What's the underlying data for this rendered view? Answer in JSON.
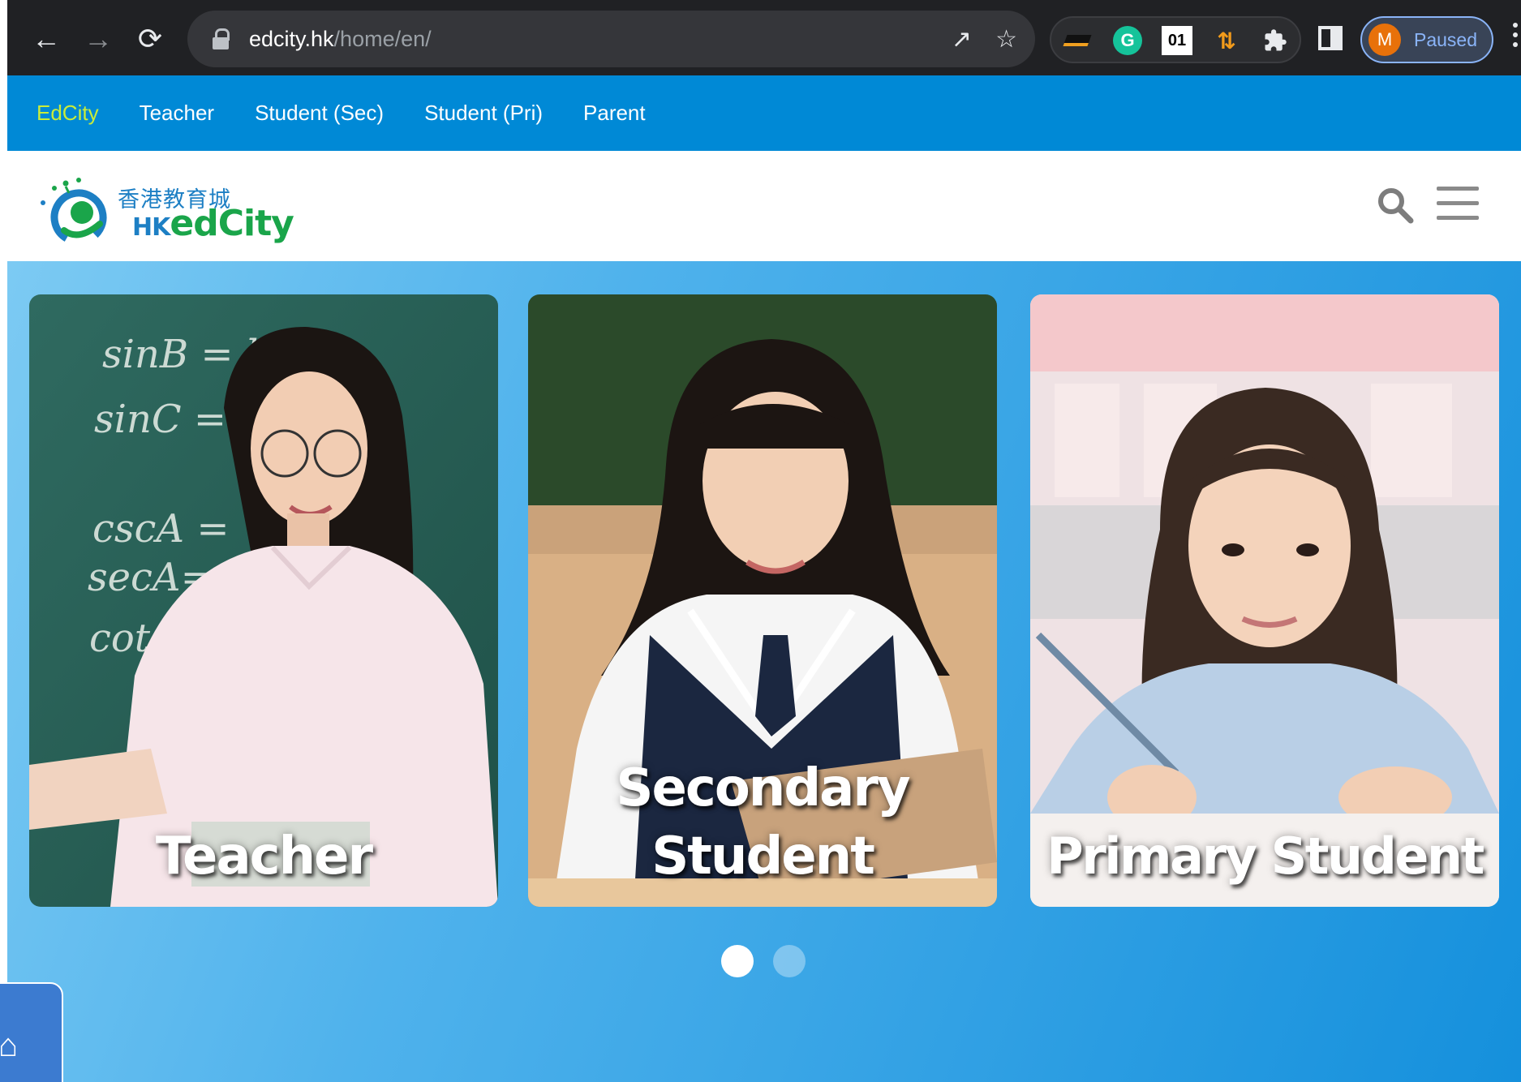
{
  "browser": {
    "url_host": "edcity.hk",
    "url_path": "/home/en/",
    "extensions": {
      "grammarly": "G",
      "ext_01": "01"
    },
    "profile": {
      "initial": "M",
      "status": "Paused"
    }
  },
  "site_nav": {
    "items": [
      {
        "label": "EdCity",
        "active": true
      },
      {
        "label": "Teacher",
        "active": false
      },
      {
        "label": "Student (Sec)",
        "active": false
      },
      {
        "label": "Student (Pri)",
        "active": false
      },
      {
        "label": "Parent",
        "active": false
      }
    ]
  },
  "header": {
    "logo_cn": "香港教育城",
    "logo_en_prefix": "HK",
    "logo_en_main": "edCity"
  },
  "hero": {
    "cards": [
      {
        "label_line1": "Teacher",
        "label_line2": ""
      },
      {
        "label_line1": "Secondary",
        "label_line2": "Student"
      },
      {
        "label_line1": "Primary Student",
        "label_line2": ""
      }
    ],
    "carousel": {
      "pages": 2,
      "active_index": 0
    }
  },
  "icons": {
    "back": "arrow-left-icon",
    "forward": "arrow-right-icon",
    "reload": "reload-icon",
    "lock": "lock-icon",
    "share": "share-icon",
    "bookmark": "star-icon",
    "extensions": "puzzle-icon",
    "side_panel": "side-panel-icon",
    "menu": "kebab-menu-icon",
    "search": "search-icon",
    "hamburger": "hamburger-icon",
    "home": "home-icon"
  },
  "colors": {
    "nav_bar": "#0089d6",
    "nav_active": "#c8ec3a",
    "logo_green": "#1aa54a",
    "logo_blue": "#1d7fc4"
  }
}
